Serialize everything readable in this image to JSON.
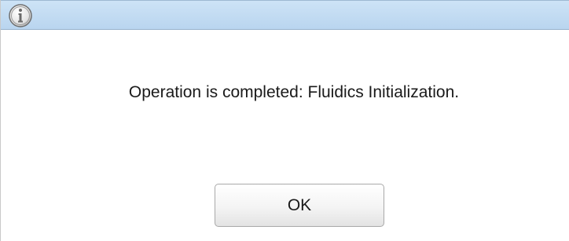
{
  "window": {
    "title": "",
    "icon": "info-icon",
    "accent_color": "#c4dcf2"
  },
  "dialog": {
    "message": "Operation is completed: Fluidics Initialization.",
    "ok_label": "OK"
  }
}
